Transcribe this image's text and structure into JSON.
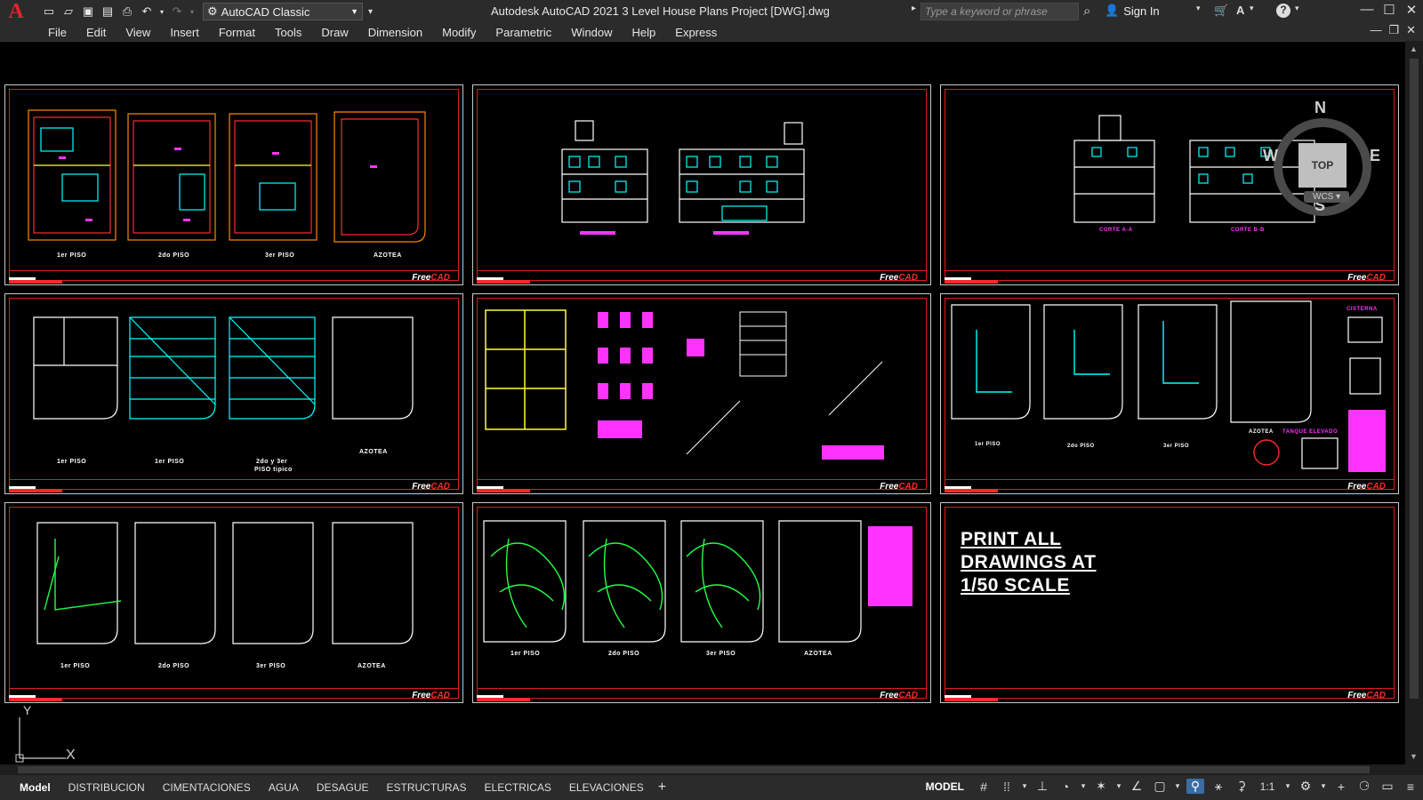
{
  "titlebar": {
    "app_logo": "A",
    "workspace": "AutoCAD Classic",
    "title": "Autodesk AutoCAD 2021    3 Level House Plans Project [DWG].dwg",
    "search_placeholder": "Type a keyword or phrase",
    "sign_in": "Sign In"
  },
  "menu": [
    "File",
    "Edit",
    "View",
    "Insert",
    "Format",
    "Tools",
    "Draw",
    "Dimension",
    "Modify",
    "Parametric",
    "Window",
    "Help",
    "Express"
  ],
  "sheets": {
    "brand_main": "Free",
    "brand_accent": "CAD",
    "s1": {
      "labels": [
        "1er PISO",
        "2do PISO",
        "3er PISO",
        "AZOTEA"
      ]
    },
    "s3": {
      "labels": [
        "CORTE A-A",
        "CORTE B-B"
      ]
    },
    "s4": {
      "labels": [
        "1er PISO",
        "1er PISO",
        "2do y 3er",
        "PISO tipico",
        "AZOTEA"
      ]
    },
    "s6": {
      "labels": [
        "1er PISO",
        "2do PISO",
        "3er PISO",
        "AZOTEA",
        "CISTERNA",
        "TANQUE ELEVADO"
      ]
    },
    "s7": {
      "labels": [
        "1er PISO",
        "2do PISO",
        "3er PISO",
        "AZOTEA"
      ]
    },
    "s8": {
      "labels": [
        "1er PISO",
        "2do PISO",
        "3er PISO",
        "AZOTEA"
      ]
    }
  },
  "print_note": [
    "PRINT ALL",
    "DRAWINGS AT",
    "1/50 SCALE"
  ],
  "viewcube": {
    "top": "TOP",
    "north": "N",
    "south": "S",
    "east": "E",
    "west": "W",
    "wcs": "WCS"
  },
  "ucs": {
    "y": "Y",
    "x": "X"
  },
  "layout_tabs": [
    "Model",
    "DISTRIBUCION",
    "CIMENTACIONES",
    "AGUA",
    "DESAGUE",
    "ESTRUCTURAS",
    "ELECTRICAS",
    "ELEVACIONES"
  ],
  "status": {
    "model": "MODEL",
    "scale": "1:1"
  },
  "colors": {
    "border_red": "#e01a1a",
    "magenta": "#ff33ff",
    "cyan": "#00ffff",
    "green": "#22ff44",
    "yellow": "#ffff33"
  }
}
